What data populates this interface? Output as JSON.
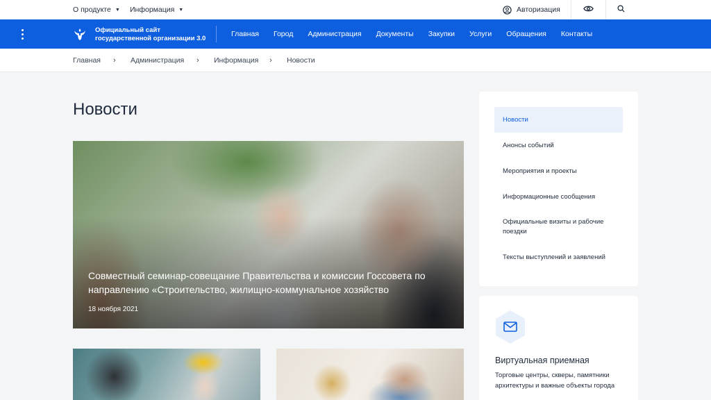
{
  "colors": {
    "brand": "#0d5fe0",
    "active_bg": "#ebf1fb",
    "page_bg": "#f4f5f7"
  },
  "topbar": {
    "product_menu": "О продукте",
    "info_menu": "Информация",
    "auth_label": "Авторизация",
    "auth_icon": "user-circle-icon",
    "visibility_icon": "eye-icon",
    "search_icon": "search-icon"
  },
  "navbar": {
    "site_title_line1": "Официальный сайт",
    "site_title_line2": "государственной организации 3.0",
    "links": [
      "Главная",
      "Город",
      "Администрация",
      "Документы",
      "Закупки",
      "Услуги",
      "Обращения",
      "Контакты"
    ]
  },
  "breadcrumb": {
    "items": [
      "Главная",
      "Администрация",
      "Информация",
      "Новости"
    ],
    "separator": "›"
  },
  "page": {
    "title": "Новости"
  },
  "featured": {
    "title": "Совместный семинар-совещание Правительства и комиссии Госсовета по направлению «Строительство, жилищно-коммунальное хозяйство",
    "date": "18 ноября 2021"
  },
  "sidebar": {
    "items": [
      "Новости",
      "Анонсы событий",
      "Мероприятия и проекты",
      "Информационные сообщения",
      "Официальные визиты и рабочие поездки",
      "Тексты выступлений и заявлений"
    ],
    "active_index": 0
  },
  "reception": {
    "icon": "mail-icon",
    "title": "Виртуальная приемная",
    "text": "Торговые центры, скверы, памятники архитектуры и важные объекты города"
  }
}
